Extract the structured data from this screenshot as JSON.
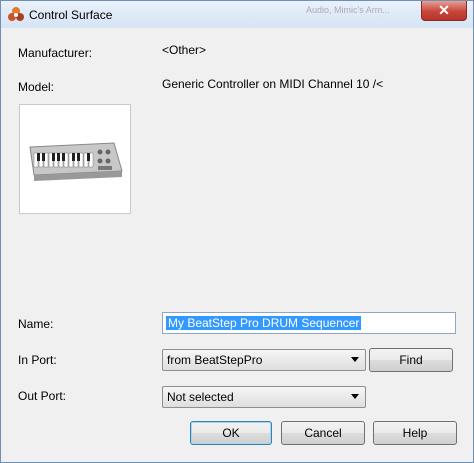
{
  "window": {
    "title": "Control Surface",
    "close_label": "✕",
    "background_title": "Audio, Mimic's Arm..."
  },
  "manufacturer": {
    "label": "Manufacturer:",
    "value": "<Other>"
  },
  "model": {
    "label": "Model:",
    "value": "Generic Controller on MIDI Channel 10 /<"
  },
  "name": {
    "label": "Name:",
    "value": "My BeatStep Pro DRUM Sequencer"
  },
  "in_port": {
    "label": "In Port:",
    "value": "from BeatStepPro",
    "find_label": "Find"
  },
  "out_port": {
    "label": "Out Port:",
    "value": "Not selected"
  },
  "buttons": {
    "ok": "OK",
    "cancel": "Cancel",
    "help": "Help"
  }
}
